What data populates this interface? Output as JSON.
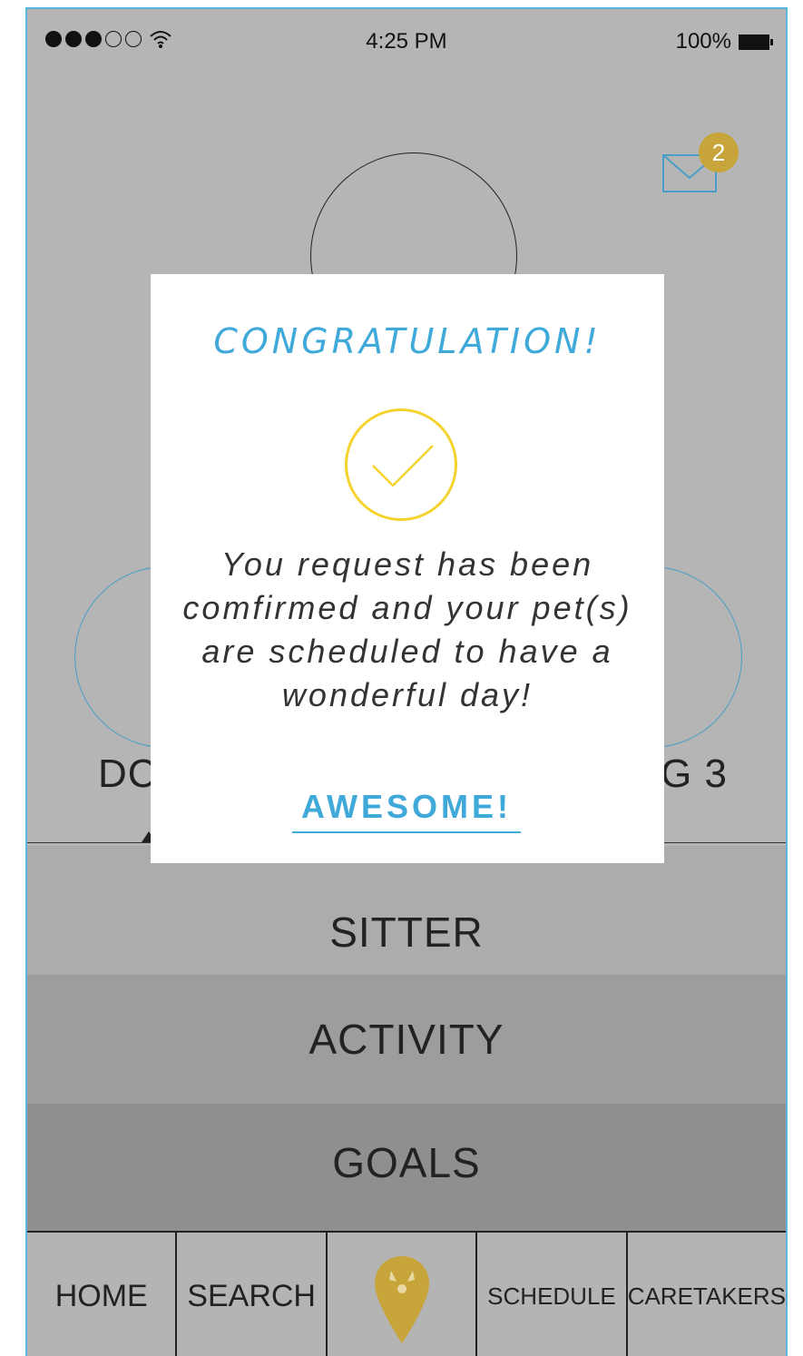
{
  "status_bar": {
    "signal_strength": "3 of 5",
    "wifi_icon": "wifi-icon",
    "time": "4:25 PM",
    "battery": "100%",
    "battery_icon": "battery-full-icon"
  },
  "header": {
    "mail_icon": "mail-icon",
    "unread_count": "2"
  },
  "pets": {
    "left_label": "DC",
    "right_label": "G 3"
  },
  "menu": {
    "items": [
      "SITTER",
      "ACTIVITY",
      "GOALS"
    ]
  },
  "tabbar": {
    "tabs": [
      "HOME",
      "SEARCH",
      "",
      "SCHEDULE",
      "CARETAKERS"
    ],
    "center_icon": "location-pin-dog-icon"
  },
  "modal": {
    "title": "CONGRATULATION!",
    "check_icon": "checkmark-icon",
    "message": "You request has been comfirmed and your pet(s) are scheduled to have a wonderful day!",
    "button_label": "AWESOME!"
  },
  "colors": {
    "accent": "#3fa9d9",
    "check": "#f4d32f",
    "badge": "#c7a53b",
    "background": "#b5b5b5"
  }
}
